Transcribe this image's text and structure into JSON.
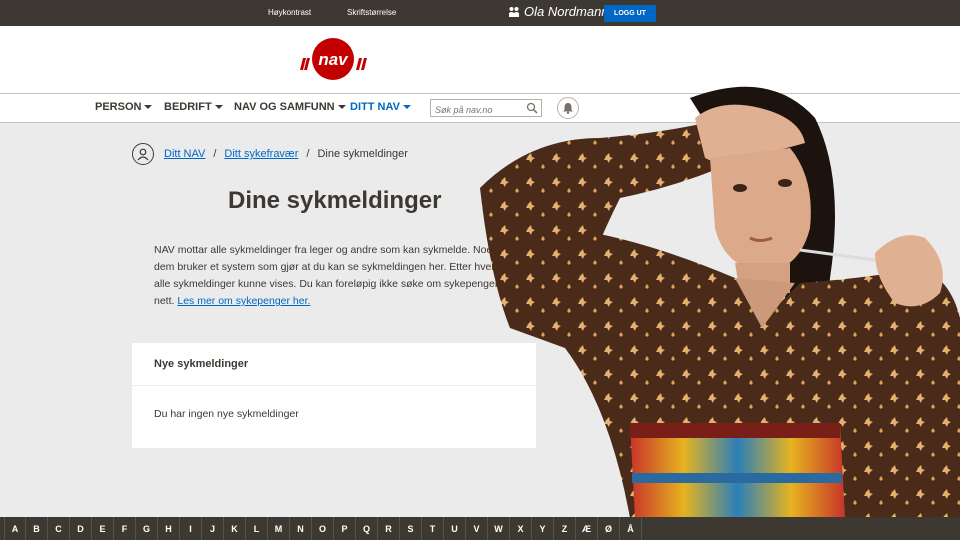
{
  "topbar": {
    "contrast_label": "Høykontrast",
    "fontsize_label": "Skriftstørrelse",
    "user_name": "Ola Nordmann",
    "logout_label": "LOGG UT"
  },
  "logo": {
    "text": "nav"
  },
  "nav": {
    "items": [
      {
        "label": "PERSON"
      },
      {
        "label": "BEDRIFT"
      },
      {
        "label": "NAV OG SAMFUNN"
      },
      {
        "label": "DITT NAV"
      }
    ],
    "search_placeholder": "Søk på nav.no"
  },
  "breadcrumb": {
    "items": [
      "Ditt NAV",
      "Ditt sykefravær",
      "Dine sykmeldinger"
    ],
    "separator": "/"
  },
  "main": {
    "title": "Dine sykmeldinger",
    "intro_text": "NAV mottar alle sykmeldinger fra leger og andre som kan sykmelde. Noen av dem bruker et system som gjør at du kan se sykmeldingen her. Etter hvert vil alle sykmeldinger kunne vises. Du kan foreløpig ikke søke om sykepenger på nett.",
    "intro_link": "Les mer om sykepenger her.",
    "panel_title": "Nye sykmeldinger",
    "panel_body": "Du har ingen nye sykmeldinger"
  },
  "alphabet": [
    "A",
    "B",
    "C",
    "D",
    "E",
    "F",
    "G",
    "H",
    "I",
    "J",
    "K",
    "L",
    "M",
    "N",
    "O",
    "P",
    "Q",
    "R",
    "S",
    "T",
    "U",
    "V",
    "W",
    "X",
    "Y",
    "Z",
    "Æ",
    "Ø",
    "Å"
  ],
  "colors": {
    "brand_red": "#c30000",
    "link_blue": "#0067c5",
    "dark": "#3e3832",
    "background": "#ebebeb"
  }
}
